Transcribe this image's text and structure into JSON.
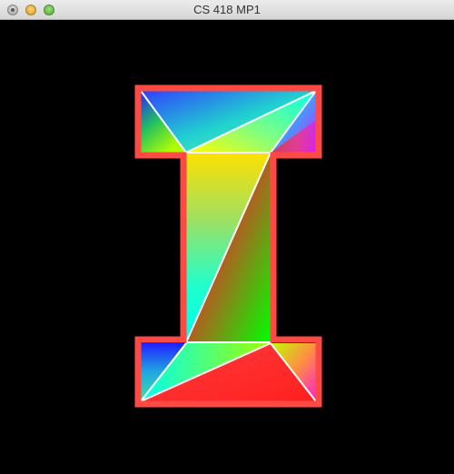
{
  "window": {
    "title": "CS 418 MP1"
  },
  "canvas": {
    "background": "#000000",
    "outline_color": "#ff4a44",
    "edge_color": "#ffffff",
    "shape": "block-letter-I"
  },
  "icons": {
    "close": "close-icon",
    "minimize": "minimize-icon",
    "maximize": "maximize-icon"
  }
}
